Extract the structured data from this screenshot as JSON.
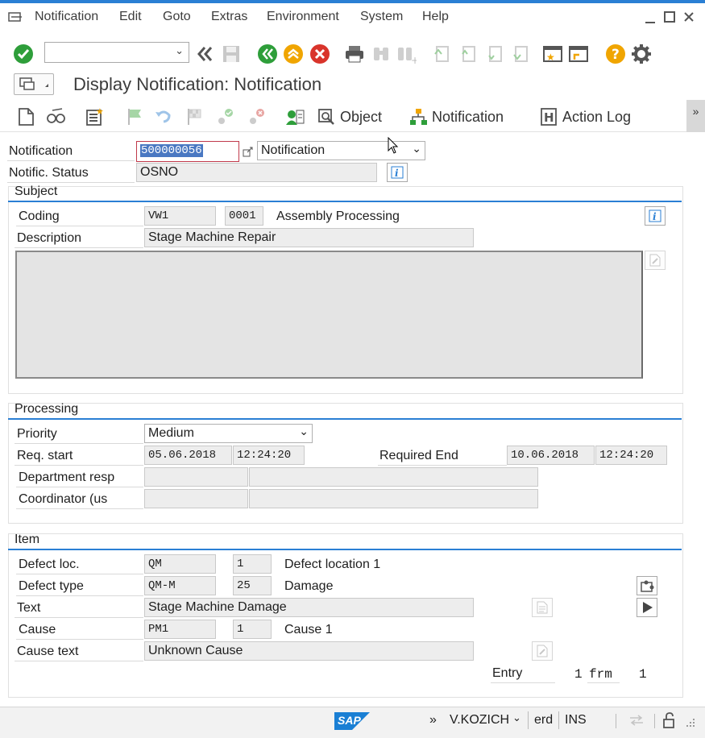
{
  "menu": {
    "items": [
      "Notification",
      "Edit",
      "Goto",
      "Extras",
      "Environment",
      "System",
      "Help"
    ]
  },
  "title": "Display Notification: Notification",
  "app_toolbar": {
    "object_label": "Object",
    "notification_label": "Notification",
    "action_log_label": "Action Log",
    "more": "»"
  },
  "header": {
    "notification_label": "Notification",
    "notification_value": "500000056",
    "notification_type": "Notification",
    "status_label": "Notific. Status",
    "status_value": "OSNO"
  },
  "subject": {
    "heading": "Subject",
    "coding_label": "Coding",
    "coding_group": "VW1",
    "coding_code": "0001",
    "coding_text": "Assembly Processing",
    "description_label": "Description",
    "description_value": "Stage Machine Repair"
  },
  "processing": {
    "heading": "Processing",
    "priority_label": "Priority",
    "priority_value": "Medium",
    "req_start_label": "Req. start",
    "req_start_date": "05.06.2018",
    "req_start_time": "12:24:20",
    "required_end_label": "Required End",
    "required_end_date": "10.06.2018",
    "required_end_time": "12:24:20",
    "department_label": "Department resp",
    "coordinator_label": "Coordinator (us"
  },
  "item": {
    "heading": "Item",
    "defect_loc_label": "Defect loc.",
    "defect_loc_group": "QM",
    "defect_loc_code": "1",
    "defect_loc_text": "Defect location 1",
    "defect_type_label": "Defect type",
    "defect_type_group": "QM-M",
    "defect_type_code": "25",
    "defect_type_text": "Damage",
    "text_label": "Text",
    "text_value": "Stage Machine Damage",
    "cause_label": "Cause",
    "cause_group": "PM1",
    "cause_code": "1",
    "cause_text": "Cause 1",
    "cause_text_label": "Cause text",
    "cause_text_value": "Unknown Cause",
    "entry_label": "Entry",
    "entry_value": "1",
    "frm_label": "frm",
    "frm_value": "1"
  },
  "status_bar": {
    "logo": "SAP",
    "more": "»",
    "user": "V.KOZICH",
    "system": "erd",
    "mode": "INS"
  },
  "colors": {
    "accent": "#2a7fd4",
    "green": "#2e9e3a",
    "orange": "#f0a500",
    "red": "#d9342b"
  }
}
